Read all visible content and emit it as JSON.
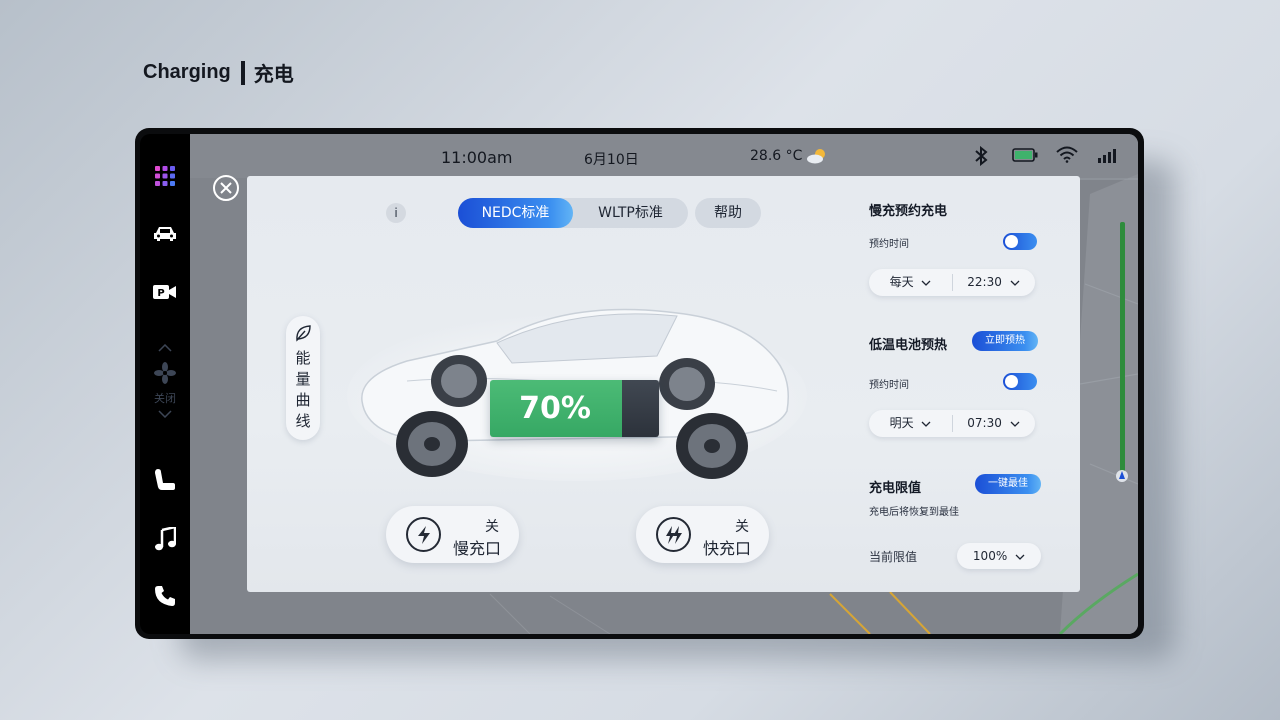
{
  "heading": {
    "title_en": "Charging",
    "title_cn": "充电"
  },
  "sidebar": {
    "items": [
      {
        "name": "apps-grid-icon"
      },
      {
        "name": "car-icon"
      },
      {
        "name": "parking-camera-icon"
      },
      {
        "name": "seat-icon"
      },
      {
        "name": "music-icon"
      },
      {
        "name": "phone-icon"
      }
    ],
    "fan_label": "关闭"
  },
  "statusbar": {
    "time": "11:00am",
    "date": "6月10日",
    "temperature": "28.6 °C",
    "weather_icon": "partly-cloudy-icon",
    "icons": [
      "bluetooth-icon",
      "battery-status-icon",
      "wifi-icon",
      "signal-icon"
    ]
  },
  "panel": {
    "info_label": "i",
    "tabs": [
      {
        "label": "NEDC标准",
        "active": true
      },
      {
        "label": "WLTP标准",
        "active": false
      }
    ],
    "help_label": "帮助",
    "energy_curve_label": "能量曲线",
    "battery": {
      "percent_text": "70%",
      "level": 0.7
    },
    "charge_ports": [
      {
        "state": "关",
        "name": "慢充口"
      },
      {
        "state": "关",
        "name": "快充口"
      }
    ]
  },
  "settings": {
    "slow_charge": {
      "title": "慢充预约充电",
      "time_label": "预约时间",
      "toggle_on": true,
      "day": "每天",
      "time": "22:30"
    },
    "preheat": {
      "title": "低温电池预热",
      "button": "立即预热",
      "time_label": "预约时间",
      "toggle_on": true,
      "day": "明天",
      "time": "07:30"
    },
    "limit": {
      "title": "充电限值",
      "button": "一键最佳",
      "note": "充电后将恢复到最佳",
      "current_label": "当前限值",
      "current_value": "100%"
    }
  },
  "colors": {
    "accent_blue": "#1b4fd6",
    "accent_light": "#3b8ff0",
    "battery_green": "#3fb26c",
    "battery_empty": "#2f353e"
  }
}
